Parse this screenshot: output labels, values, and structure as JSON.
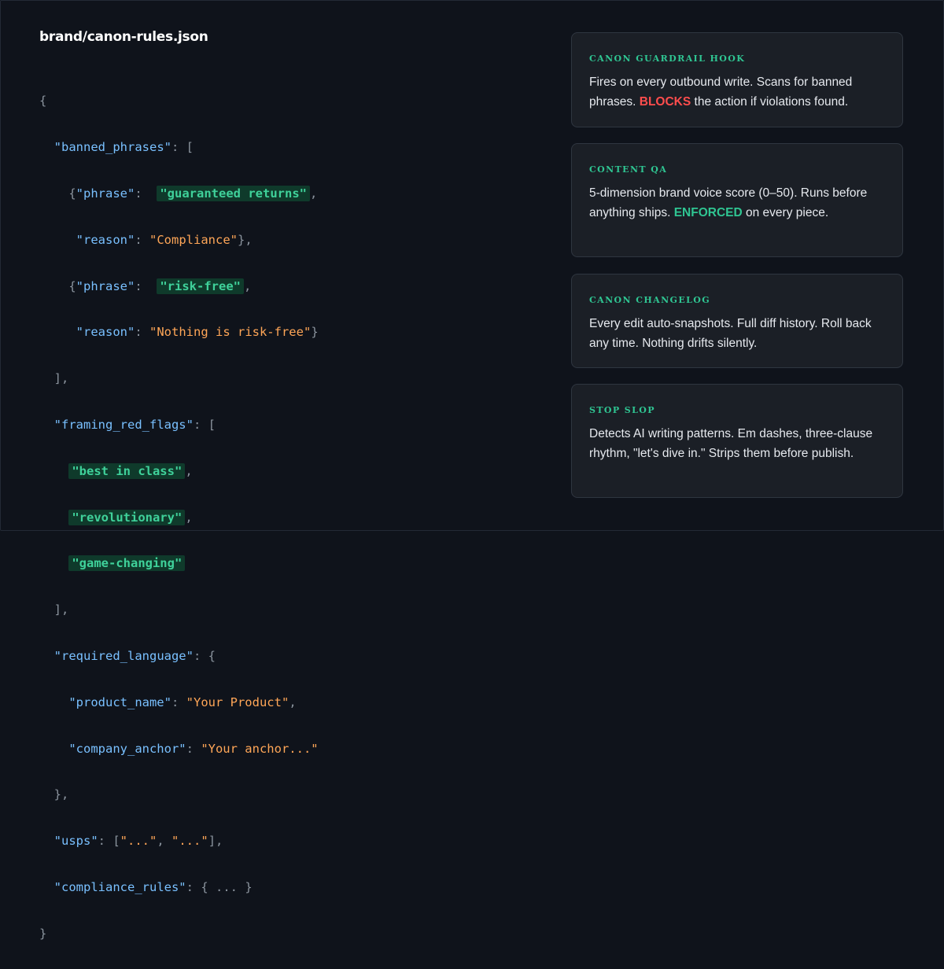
{
  "file": {
    "title": "brand/canon-rules.json"
  },
  "code": {
    "open_brace": "{",
    "banned_key": "\"banned_phrases\"",
    "phrase_key": "\"phrase\"",
    "reason_key": "\"reason\"",
    "phrase1": "\"guaranteed returns\"",
    "reason1": "\"Compliance\"",
    "phrase2": "\"risk-free\"",
    "reason2": "\"Nothing is risk-free\"",
    "framing_key": "\"framing_red_flags\"",
    "flags": [
      "\"best in class\"",
      "\"revolutionary\"",
      "\"game-changing\""
    ],
    "required_key": "\"required_language\"",
    "product_key": "\"product_name\"",
    "product_val": "\"Your Product\"",
    "anchor_key": "\"company_anchor\"",
    "anchor_val": "\"Your anchor...\"",
    "usps_key": "\"usps\"",
    "usps_val1": "\"...\"",
    "usps_val2": "\"...\"",
    "compliance_key": "\"compliance_rules\"",
    "compliance_val": "{ ... }",
    "close_brace": "}"
  },
  "cards": [
    {
      "title": "CANON GUARDRAIL HOOK",
      "text_before": "Fires on every outbound write. Scans for banned phrases. ",
      "highlight": "BLOCKS",
      "text_after": " the action if violations found.",
      "highlight_color": "#ff4d4d"
    },
    {
      "title": "CONTENT QA",
      "text_before": "5-dimension brand voice score (0–50). Runs before anything ships. ",
      "highlight": "ENFORCED",
      "text_after": " on every piece.",
      "highlight_color": "#2fc592"
    },
    {
      "title": "CANON CHANGELOG",
      "text": "Every edit auto-snapshots. Full diff history. Roll back any time. Nothing drifts silently."
    },
    {
      "title": "STOP SLOP",
      "text": "Detects AI writing patterns. Em dashes, three-clause rhythm, \"let's dive in.\" Strips them before publish."
    }
  ],
  "colors": {
    "background": "#0f131b",
    "card_background": "#1b1f26",
    "json_key": "#79c0ff",
    "json_string": "#ffa657",
    "highlight_text": "#3fd19a",
    "highlight_bg": "#0f3a2b",
    "accent_green": "#2fc592",
    "accent_red": "#ff4d4d"
  }
}
